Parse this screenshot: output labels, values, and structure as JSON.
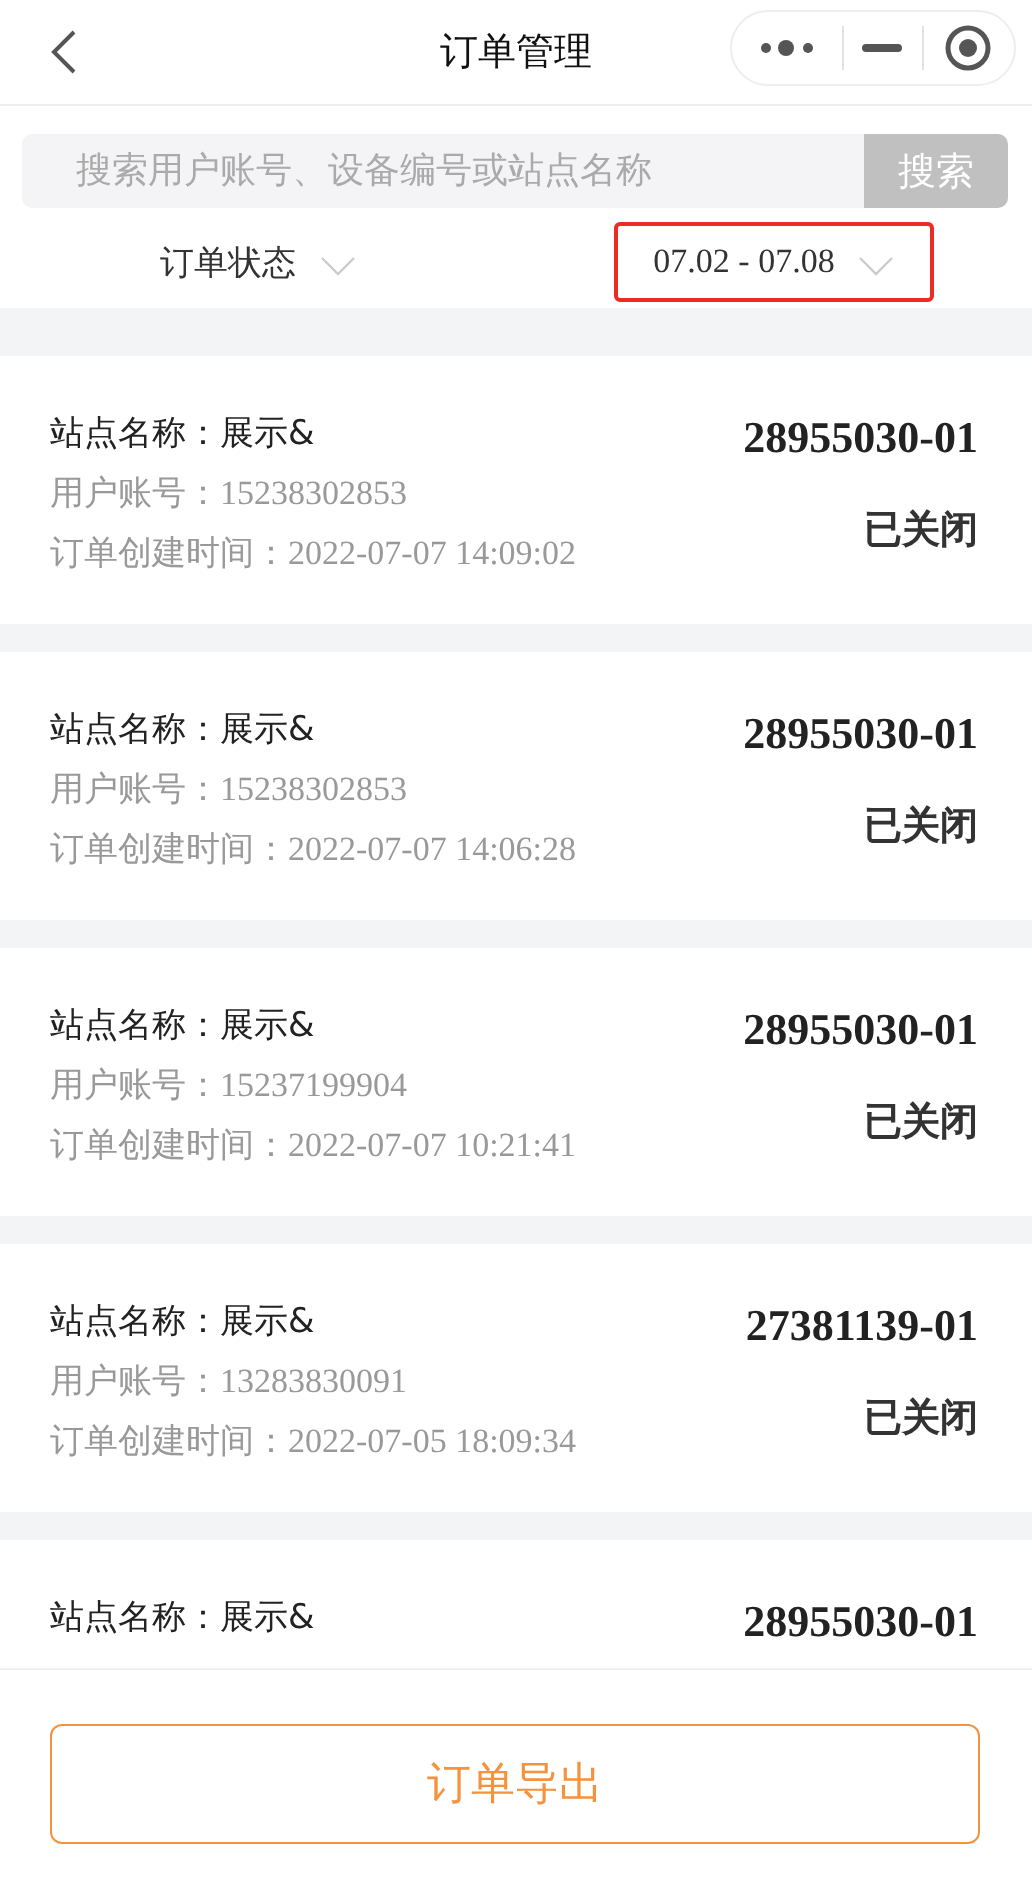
{
  "nav": {
    "title": "订单管理"
  },
  "search": {
    "placeholder": "搜索用户账号、设备编号或站点名称",
    "button": "搜索"
  },
  "filters": [
    {
      "label": "订单状态",
      "highlighted": false
    },
    {
      "label": "07.02 - 07.08",
      "highlighted": true
    }
  ],
  "orders": [
    {
      "station_label": "站点名称：",
      "station": "展示&",
      "order_no": "28955030-01",
      "account_label": "用户账号：",
      "account": "15238302853",
      "time_label": "订单创建时间：",
      "time": "2022-07-07 14:09:02",
      "status": "已关闭"
    },
    {
      "station_label": "站点名称：",
      "station": "展示&",
      "order_no": "28955030-01",
      "account_label": "用户账号：",
      "account": "15238302853",
      "time_label": "订单创建时间：",
      "time": "2022-07-07 14:06:28",
      "status": "已关闭"
    },
    {
      "station_label": "站点名称：",
      "station": "展示&",
      "order_no": "28955030-01",
      "account_label": "用户账号：",
      "account": "15237199904",
      "time_label": "订单创建时间：",
      "time": "2022-07-07 10:21:41",
      "status": "已关闭"
    },
    {
      "station_label": "站点名称：",
      "station": "展示&",
      "order_no": "27381139-01",
      "account_label": "用户账号：",
      "account": "13283830091",
      "time_label": "订单创建时间：",
      "time": "2022-07-05 18:09:34",
      "status": "已关闭"
    },
    {
      "station_label": "站点名称：",
      "station": "展示&",
      "order_no": "28955030-01"
    }
  ],
  "export_button": "订单导出"
}
